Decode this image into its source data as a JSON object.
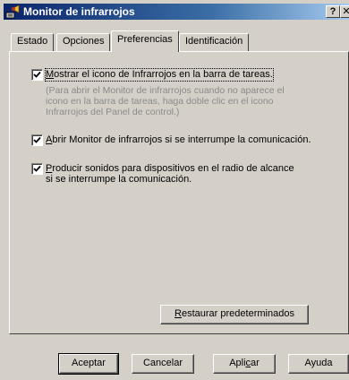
{
  "window": {
    "title": "Monitor de infrarrojos",
    "help_label": "?",
    "close_label": "✕",
    "icon": "infrared-monitor-icon"
  },
  "tabs": [
    {
      "label": "Estado",
      "active": false
    },
    {
      "label": "Opciones",
      "active": false
    },
    {
      "label": "Preferencias",
      "active": true
    },
    {
      "label": "Identificación",
      "active": false
    }
  ],
  "preferences": {
    "options": [
      {
        "label_mnemonic": "M",
        "label_rest": "ostrar el icono de Infrarrojos en la barra de tareas.",
        "checked": true,
        "hint_lines": [
          "(Para abrir el Monitor de infrarrojos cuando no aparece el",
          "icono en la barra de tareas, haga doble clic en el icono",
          "Infrarrojos del Panel de control.)"
        ]
      },
      {
        "label_mnemonic": "A",
        "label_rest": "brir Monitor de infrarrojos si se interrumpe la comunicación.",
        "checked": true
      },
      {
        "label_mnemonic": "P",
        "label_rest": "roducir sonidos para dispositivos en el radio de alcance",
        "label_line2": "si se interrumpe la comunicación.",
        "checked": true
      }
    ],
    "restore_mnemonic": "R",
    "restore_rest": "estaurar predeterminados"
  },
  "footer": {
    "accept_label": "Aceptar",
    "cancel_label": "Cancelar",
    "apply_pre": "Apli",
    "apply_mnemonic": "c",
    "apply_post": "ar",
    "help_label": "Ayuda"
  }
}
